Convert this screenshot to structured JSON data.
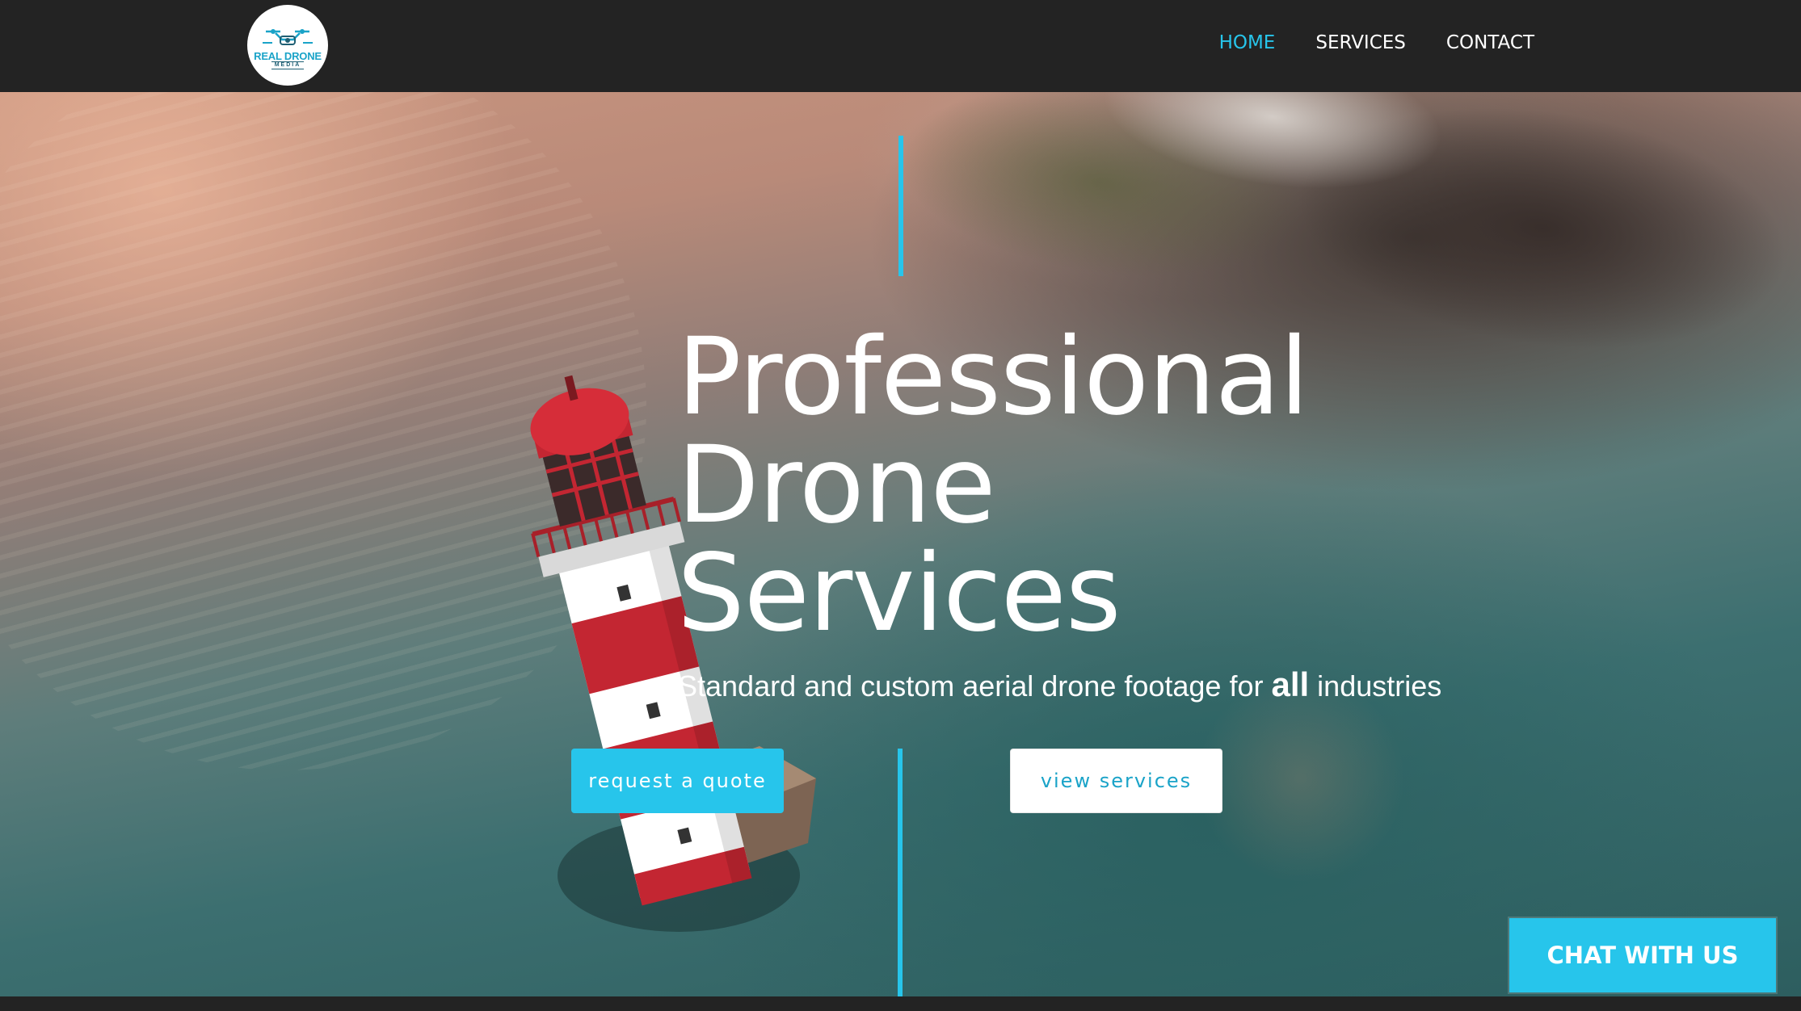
{
  "header": {
    "logo": {
      "line1": "REAL DRONE",
      "line2": "MEDIA"
    },
    "nav": [
      {
        "label": "HOME",
        "active": true
      },
      {
        "label": "SERVICES",
        "active": false
      },
      {
        "label": "CONTACT",
        "active": false
      }
    ]
  },
  "hero": {
    "headline": "Professional\nDrone\nServices",
    "subline_before": "Standard and custom aerial drone footage for ",
    "subline_emphasis": "all",
    "subline_after": " industries",
    "buttons": {
      "quote": "request a quote",
      "services": "view services"
    }
  },
  "chat": {
    "label": "CHAT WITH US"
  },
  "colors": {
    "accent": "#27c5eb",
    "header_bg": "#232323",
    "text_light": "#ffffff"
  },
  "icons": {
    "logo_mark": "drone-icon"
  }
}
